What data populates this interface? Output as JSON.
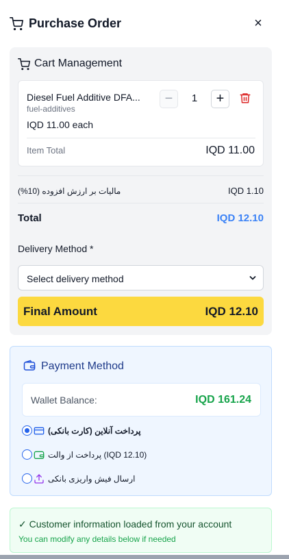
{
  "header": {
    "title": "Purchase Order",
    "close_label": "×",
    "cart_icon": "cart-icon",
    "close_icon": "close-icon"
  },
  "cart": {
    "section_title": "Cart Management",
    "item": {
      "name": "Diesel Fuel Additive DFA...",
      "category": "fuel-additives",
      "price_each": "IQD 11.00 each",
      "quantity": "1",
      "minus_label": "−",
      "plus_label": "+",
      "total_label": "Item Total",
      "total_value": "IQD 11.00"
    },
    "vat_label": "مالیات بر ارزش افزوده (10%)",
    "vat_value": "IQD 1.10",
    "total_label": "Total",
    "total_value": "IQD 12.10",
    "delivery_label": "Delivery Method *",
    "delivery_selected": "Select delivery method",
    "final_label": "Final Amount",
    "final_value": "IQD 12.10"
  },
  "payment": {
    "section_title": "Payment Method",
    "wallet_label": "Wallet Balance:",
    "wallet_value": "IQD 161.24",
    "options": [
      {
        "label": "پرداخت آنلاین (کارت بانکی)",
        "icon": "credit-card-icon",
        "selected": true
      },
      {
        "label": "پرداخت از والت (IQD 12.10)",
        "icon": "wallet-icon",
        "selected": false
      },
      {
        "label": "ارسال فیش واریزی بانکی",
        "icon": "upload-icon",
        "selected": false
      }
    ]
  },
  "info": {
    "title": "✓ Customer information loaded from your account",
    "subtitle": "You can modify any details below if needed"
  },
  "colors": {
    "accent_blue": "#3b82f6",
    "final_yellow": "#fcd93f",
    "wallet_green": "#16a34a",
    "danger_red": "#dc2626"
  }
}
